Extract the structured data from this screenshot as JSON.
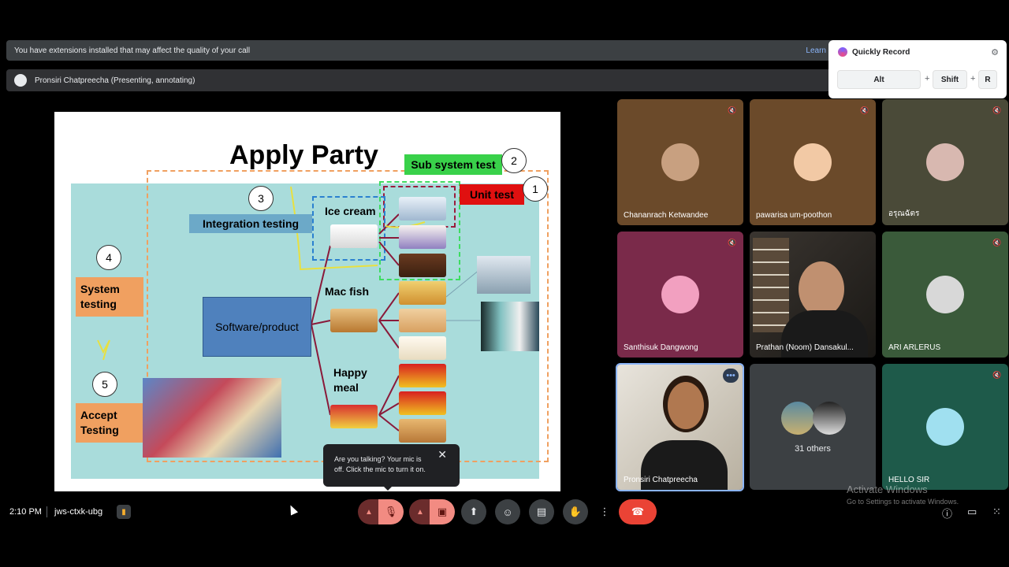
{
  "banner": {
    "text": "You have extensions installed that may affect the quality of your call",
    "learn": "Learn"
  },
  "presenter": {
    "text": "Pronsiri Chatpreecha (Presenting, annotating)"
  },
  "quick_record": {
    "title": "Quickly Record",
    "keys": [
      "Alt",
      "Shift",
      "R"
    ],
    "plus": "+"
  },
  "slide": {
    "title": "Apply  Party",
    "sub_system_test": "Sub system test",
    "unit_test": "Unit test",
    "integration_testing": "Integration testing",
    "system_testing_l1": "System",
    "system_testing_l2": "testing",
    "accept_testing_l1": "Accept",
    "accept_testing_l2": "Testing",
    "software_product": "Software/product",
    "ice_cream": "Ice cream",
    "mac_fish": "Mac fish",
    "happy_meal_l1": "Happy",
    "happy_meal_l2": "meal",
    "circles": [
      "1",
      "2",
      "3",
      "4",
      "5"
    ]
  },
  "tooltip": {
    "text_l1": "Are you talking? Your mic is",
    "text_l2": "off. Click the mic to turn it on.",
    "close": "✕"
  },
  "participants": [
    {
      "name": "Chananrach Ketwandee",
      "bg": "#6b4a2a",
      "avatar": "#c8a080"
    },
    {
      "name": "pawarisa um-poothon",
      "bg": "#6b4a2a",
      "avatar": "#f2c9a5"
    },
    {
      "name": "อรุณฉัตร",
      "bg": "#4a4a38",
      "avatar": "#d8b8b0"
    },
    {
      "name": "Santhisuk Dangwong",
      "bg": "#7a2a4a",
      "avatar": "#f2a0c0"
    },
    {
      "name": "Prathan (Noom) Dansakul...",
      "bg": "#2a2a2a",
      "avatar": "#c09070"
    },
    {
      "name": "ARI ARLERUS",
      "bg": "#3a5a3a",
      "avatar": "#d8d8d8"
    },
    {
      "name": "Pronsiri Chatpreecha",
      "bg": "#d6cfc4",
      "avatar": "#a06040"
    },
    {
      "name": "31 others",
      "bg": "#3c4043",
      "avatar": "#7aa0b0"
    },
    {
      "name": "HELLO SIR",
      "bg": "#1e5a4a",
      "avatar": "#a0e0f0"
    }
  ],
  "bottom": {
    "time": "2:10 PM",
    "separator": "|",
    "meeting_code": "jws-ctxk-ubg"
  },
  "watermark": {
    "title": "Activate Windows",
    "subtitle": "Go to Settings to activate Windows."
  },
  "colors": {
    "accent": "#8ab4f8",
    "hangup": "#ea4335",
    "mic_off": "#f28b82"
  }
}
